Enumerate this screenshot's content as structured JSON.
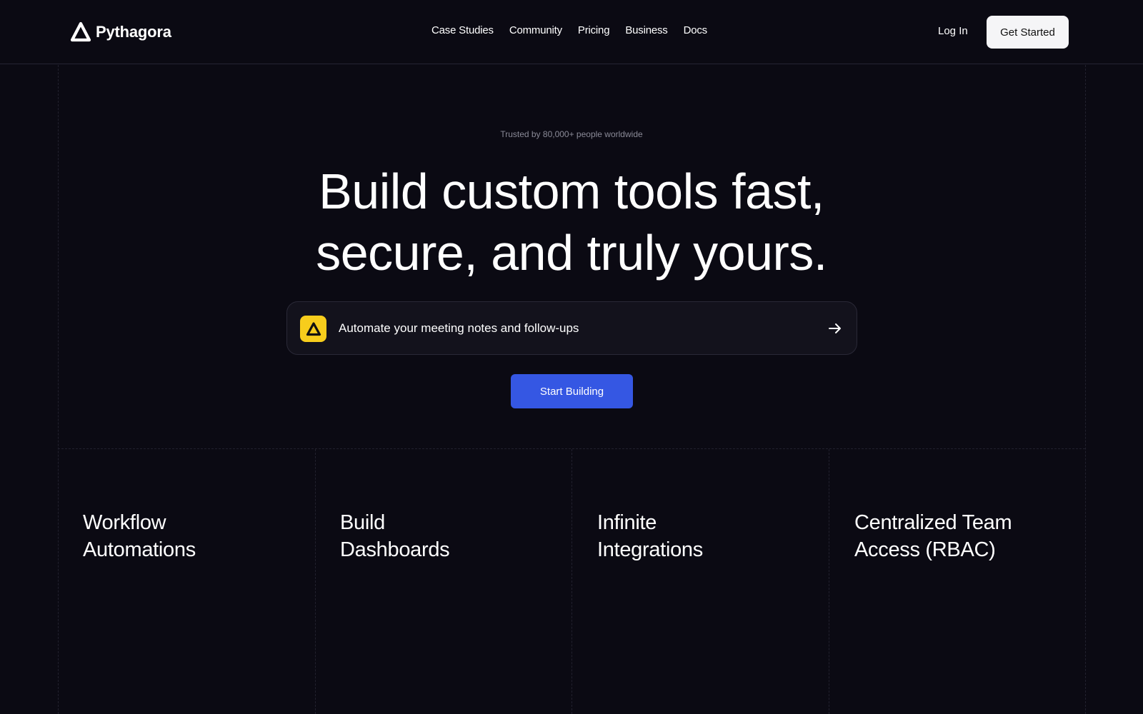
{
  "brand": {
    "name": "Pythagora",
    "icon": "pythagora-triangle-logo"
  },
  "nav": {
    "items": [
      {
        "label": "Case Studies"
      },
      {
        "label": "Community"
      },
      {
        "label": "Pricing"
      },
      {
        "label": "Business"
      },
      {
        "label": "Docs"
      }
    ],
    "login_label": "Log In",
    "cta_label": "Get Started"
  },
  "hero": {
    "trusted": "Trusted by 80,000+ people worldwide",
    "title_line1": "Build custom tools fast,",
    "title_line2": "secure, and truly yours.",
    "prompt": {
      "text": "Automate your meeting notes and follow-ups",
      "badge_icon": "pythagora-logo-icon",
      "arrow_icon": "arrow-right-icon"
    },
    "start_label": "Start Building"
  },
  "features": [
    {
      "line1": "Workflow",
      "line2": "Automations"
    },
    {
      "line1": "Build",
      "line2": "Dashboards"
    },
    {
      "line1": "Infinite",
      "line2": "Integrations"
    },
    {
      "line1": "Centralized Team",
      "line2": "Access (RBAC)"
    }
  ],
  "colors": {
    "background": "#0b0a13",
    "accent_blue": "#3557e3",
    "badge_yellow": "#f7cd1c",
    "muted_text": "#8a8a97"
  }
}
